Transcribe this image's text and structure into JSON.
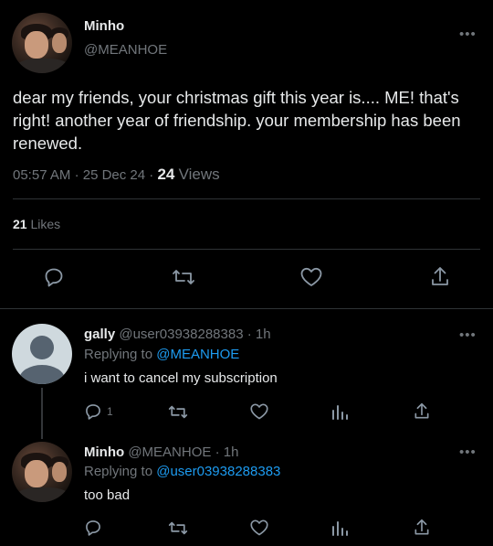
{
  "tweet": {
    "author_name": "Minho",
    "author_handle": "@MEANHOE",
    "text": "dear my friends, your christmas gift this year is.... ME! that's right! another year of friendship. your membership has been renewed.",
    "time": "05:57 AM",
    "date": "25 Dec 24",
    "views_count": "24",
    "views_label": "Views",
    "likes_count": "21",
    "likes_label": "Likes"
  },
  "replies": [
    {
      "author_name": "gally",
      "author_meta": "@user03938288383 · 1h",
      "replying_label": "Replying to",
      "replying_to": "@MEANHOE",
      "text": "i want to cancel my subscription",
      "reply_count": "1"
    },
    {
      "author_name": "Minho",
      "author_meta": "@MEANHOE · 1h",
      "replying_label": "Replying to",
      "replying_to": "@user03938288383",
      "text": "too bad"
    }
  ],
  "more_glyph": "•••",
  "colors": {
    "background": "#000000",
    "text": "#e7e9ea",
    "muted": "#71767b",
    "link": "#1d9bf0",
    "divider": "#2f3336"
  },
  "icons": [
    "reply-icon",
    "retweet-icon",
    "like-icon",
    "share-icon",
    "analytics-icon",
    "more-icon"
  ]
}
